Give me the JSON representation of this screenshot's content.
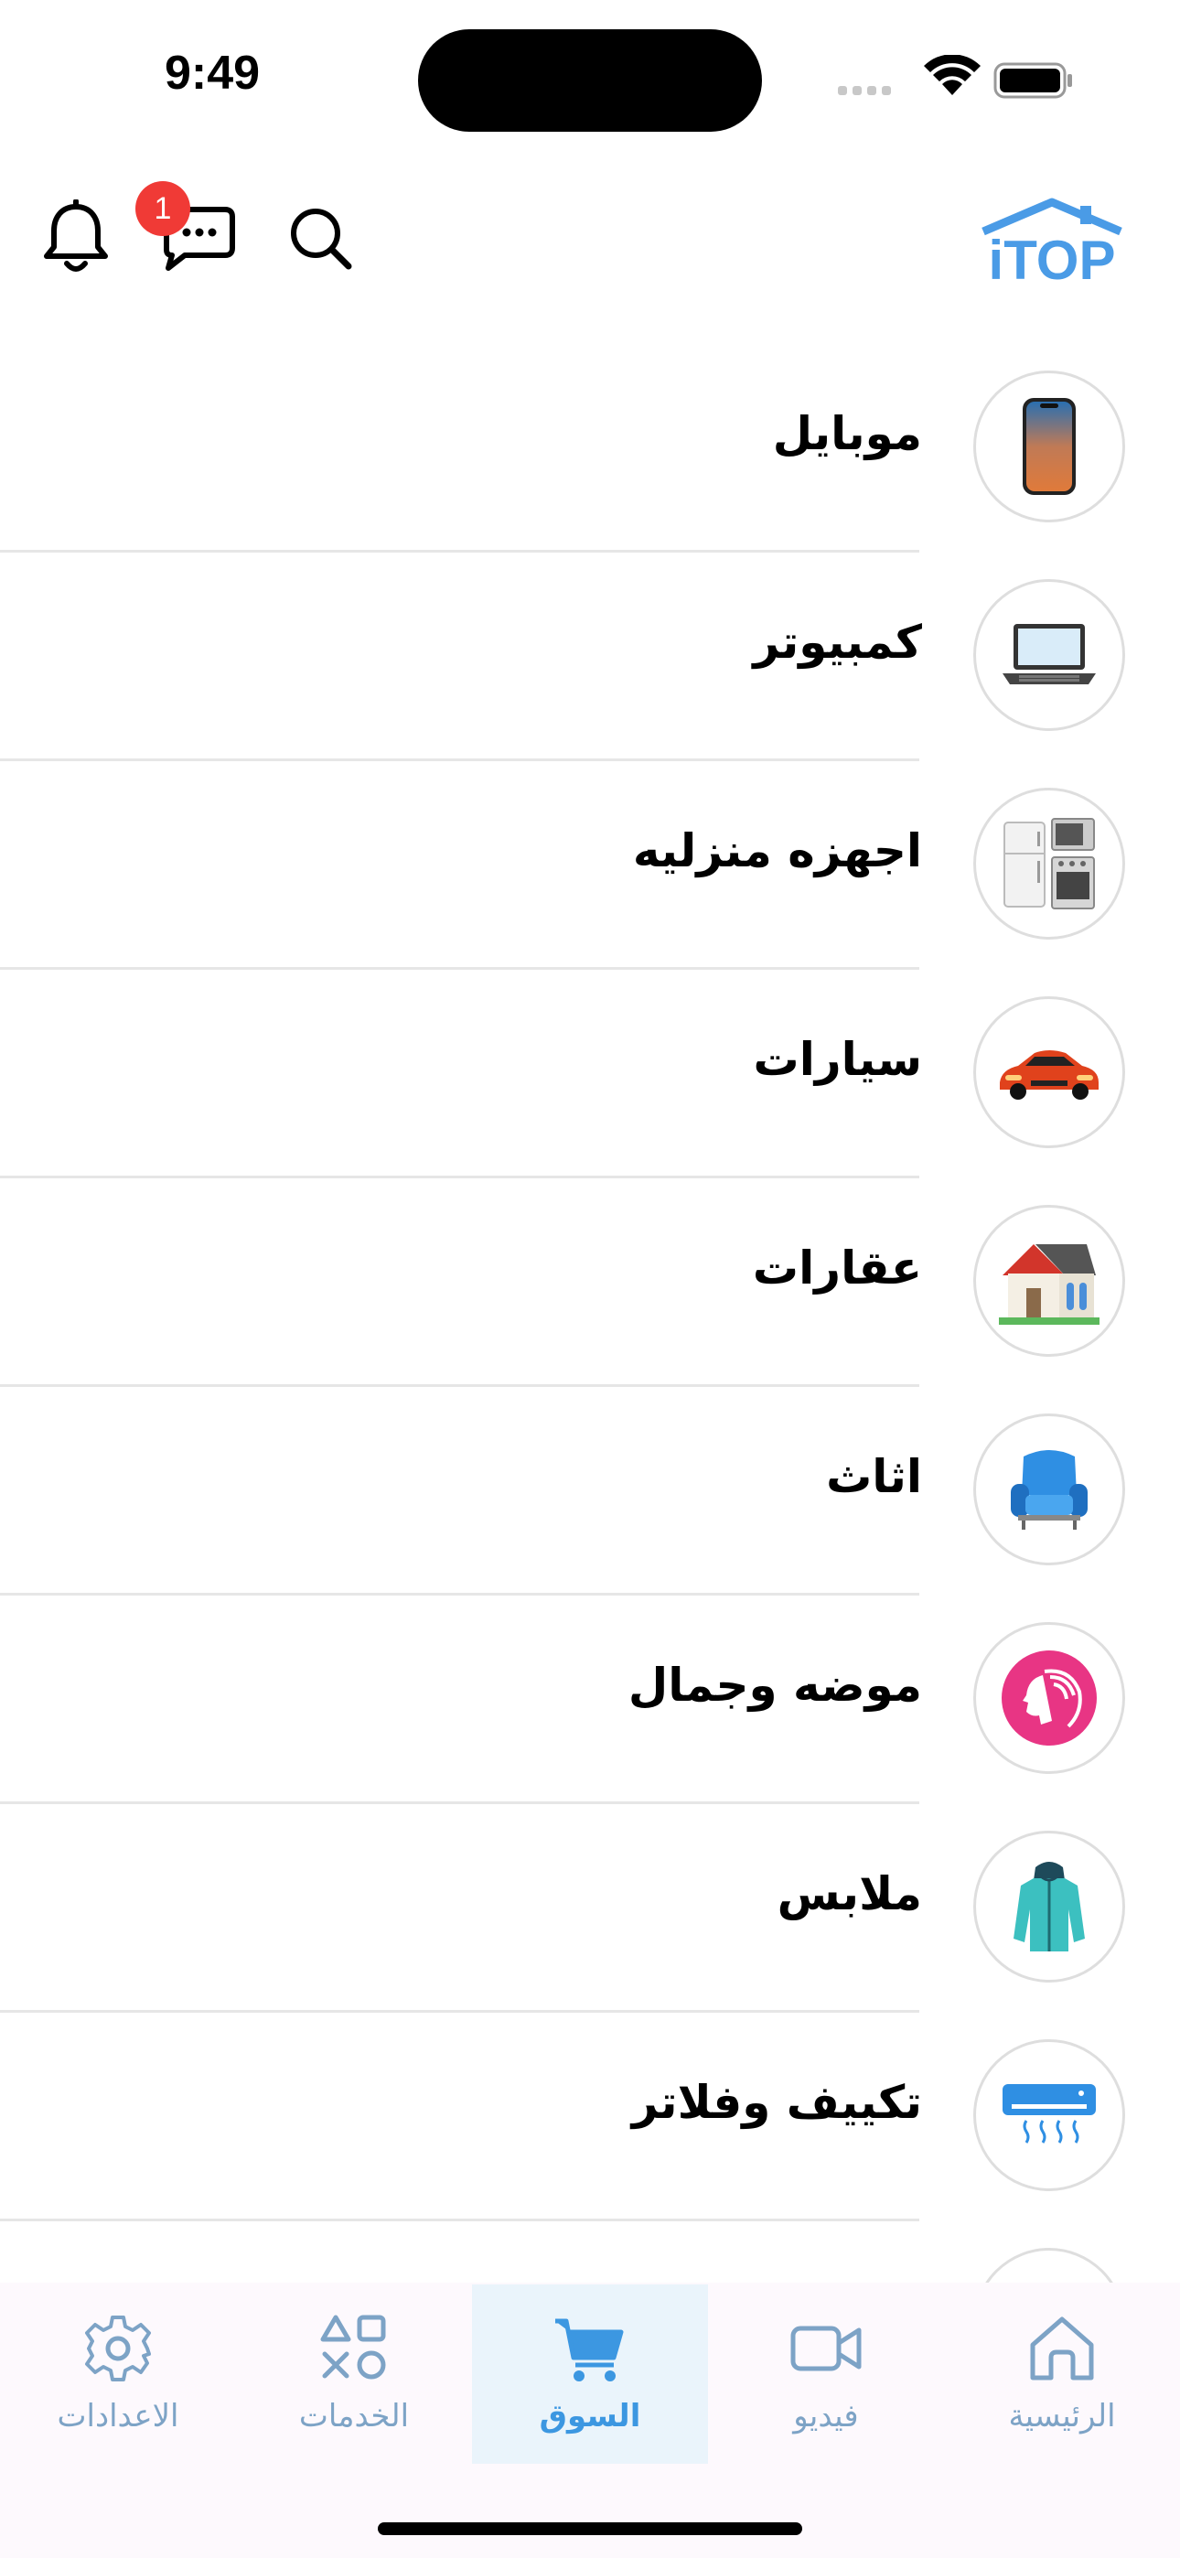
{
  "status": {
    "time": "9:49"
  },
  "header": {
    "message_badge": "1",
    "logo_text": "iTOP"
  },
  "categories": [
    {
      "label": "موبايل",
      "icon": "mobile-phone-icon"
    },
    {
      "label": "كمبيوتر",
      "icon": "laptop-icon"
    },
    {
      "label": "اجهزه منزليه",
      "icon": "home-appliances-icon"
    },
    {
      "label": "سيارات",
      "icon": "car-icon"
    },
    {
      "label": "عقارات",
      "icon": "house-icon"
    },
    {
      "label": "اثاث",
      "icon": "armchair-icon"
    },
    {
      "label": "موضه وجمال",
      "icon": "beauty-icon"
    },
    {
      "label": "ملابس",
      "icon": "jacket-icon"
    },
    {
      "label": "تكييف وفلاتر",
      "icon": "air-conditioner-icon"
    }
  ],
  "tabs": [
    {
      "label": "الرئيسية",
      "icon": "home-icon",
      "active": false
    },
    {
      "label": "فيديو",
      "icon": "video-icon",
      "active": false
    },
    {
      "label": "السوق",
      "icon": "cart-icon",
      "active": true
    },
    {
      "label": "الخدمات",
      "icon": "services-icon",
      "active": false
    },
    {
      "label": "الاعدادات",
      "icon": "settings-icon",
      "active": false
    }
  ],
  "colors": {
    "accent": "#3c97e1",
    "tab_inactive": "#7da3c6",
    "badge": "#f03a36",
    "logo": "#4a9be6"
  }
}
